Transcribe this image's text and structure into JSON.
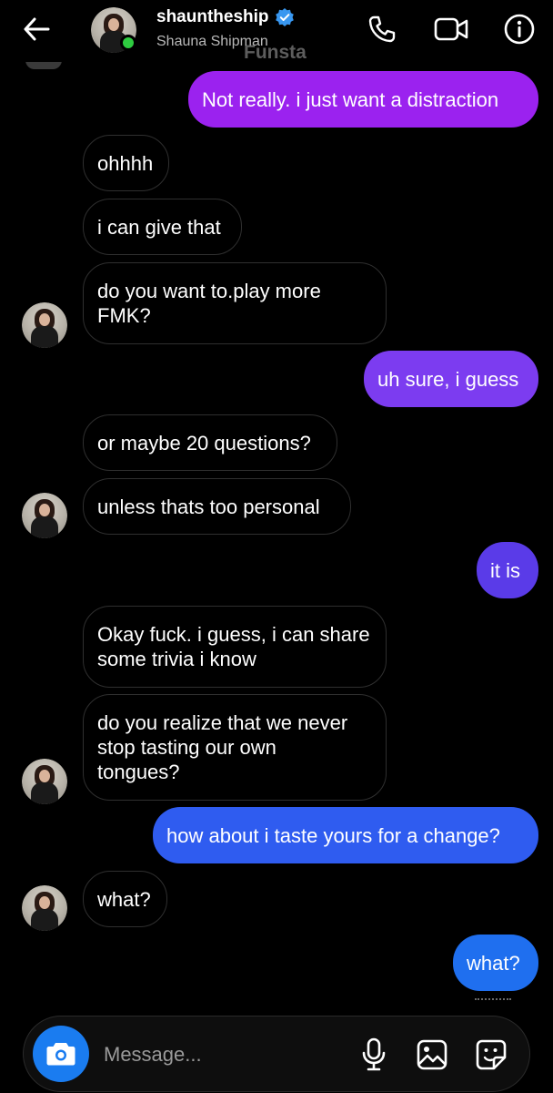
{
  "header": {
    "username": "shauntheship",
    "full_name": "Shauna Shipman",
    "watermark": "Funsta",
    "icons": [
      "back-arrow-icon",
      "verified-badge-icon",
      "phone-icon",
      "video-camera-icon",
      "info-icon"
    ]
  },
  "colors": {
    "background": "#000000",
    "incoming_border": "#2f2f2f",
    "outgoing_purple": "#9b22ef",
    "outgoing_violet": "#7c3cf0",
    "outgoing_indigo": "#5a3be8",
    "outgoing_blue": "#2f5cf0",
    "outgoing_bright_blue": "#1f6fef",
    "camera_button": "#1a7cf0",
    "online": "#2ecc40"
  },
  "messages": [
    {
      "from": "me",
      "text": "Not really. i just want a distraction"
    },
    {
      "from": "them",
      "text": "ohhhh"
    },
    {
      "from": "them",
      "text": "i can give that"
    },
    {
      "from": "them",
      "text": "do you want to.play more FMK?"
    },
    {
      "from": "me",
      "text": "uh sure, i guess"
    },
    {
      "from": "them",
      "text": "or maybe 20 questions?"
    },
    {
      "from": "them",
      "text": "unless thats too personal"
    },
    {
      "from": "me",
      "text": "it is"
    },
    {
      "from": "them",
      "text": "Okay fuck. i guess, i can share some trivia i know"
    },
    {
      "from": "them",
      "text": "do you realize that we never stop tasting our own tongues?"
    },
    {
      "from": "me",
      "text": "how about i taste yours for a change?"
    },
    {
      "from": "them",
      "text": "what?"
    },
    {
      "from": "me",
      "text": "what?"
    }
  ],
  "composer": {
    "placeholder": "Message...",
    "icons": [
      "camera-icon",
      "microphone-icon",
      "gallery-icon",
      "sticker-icon"
    ]
  }
}
